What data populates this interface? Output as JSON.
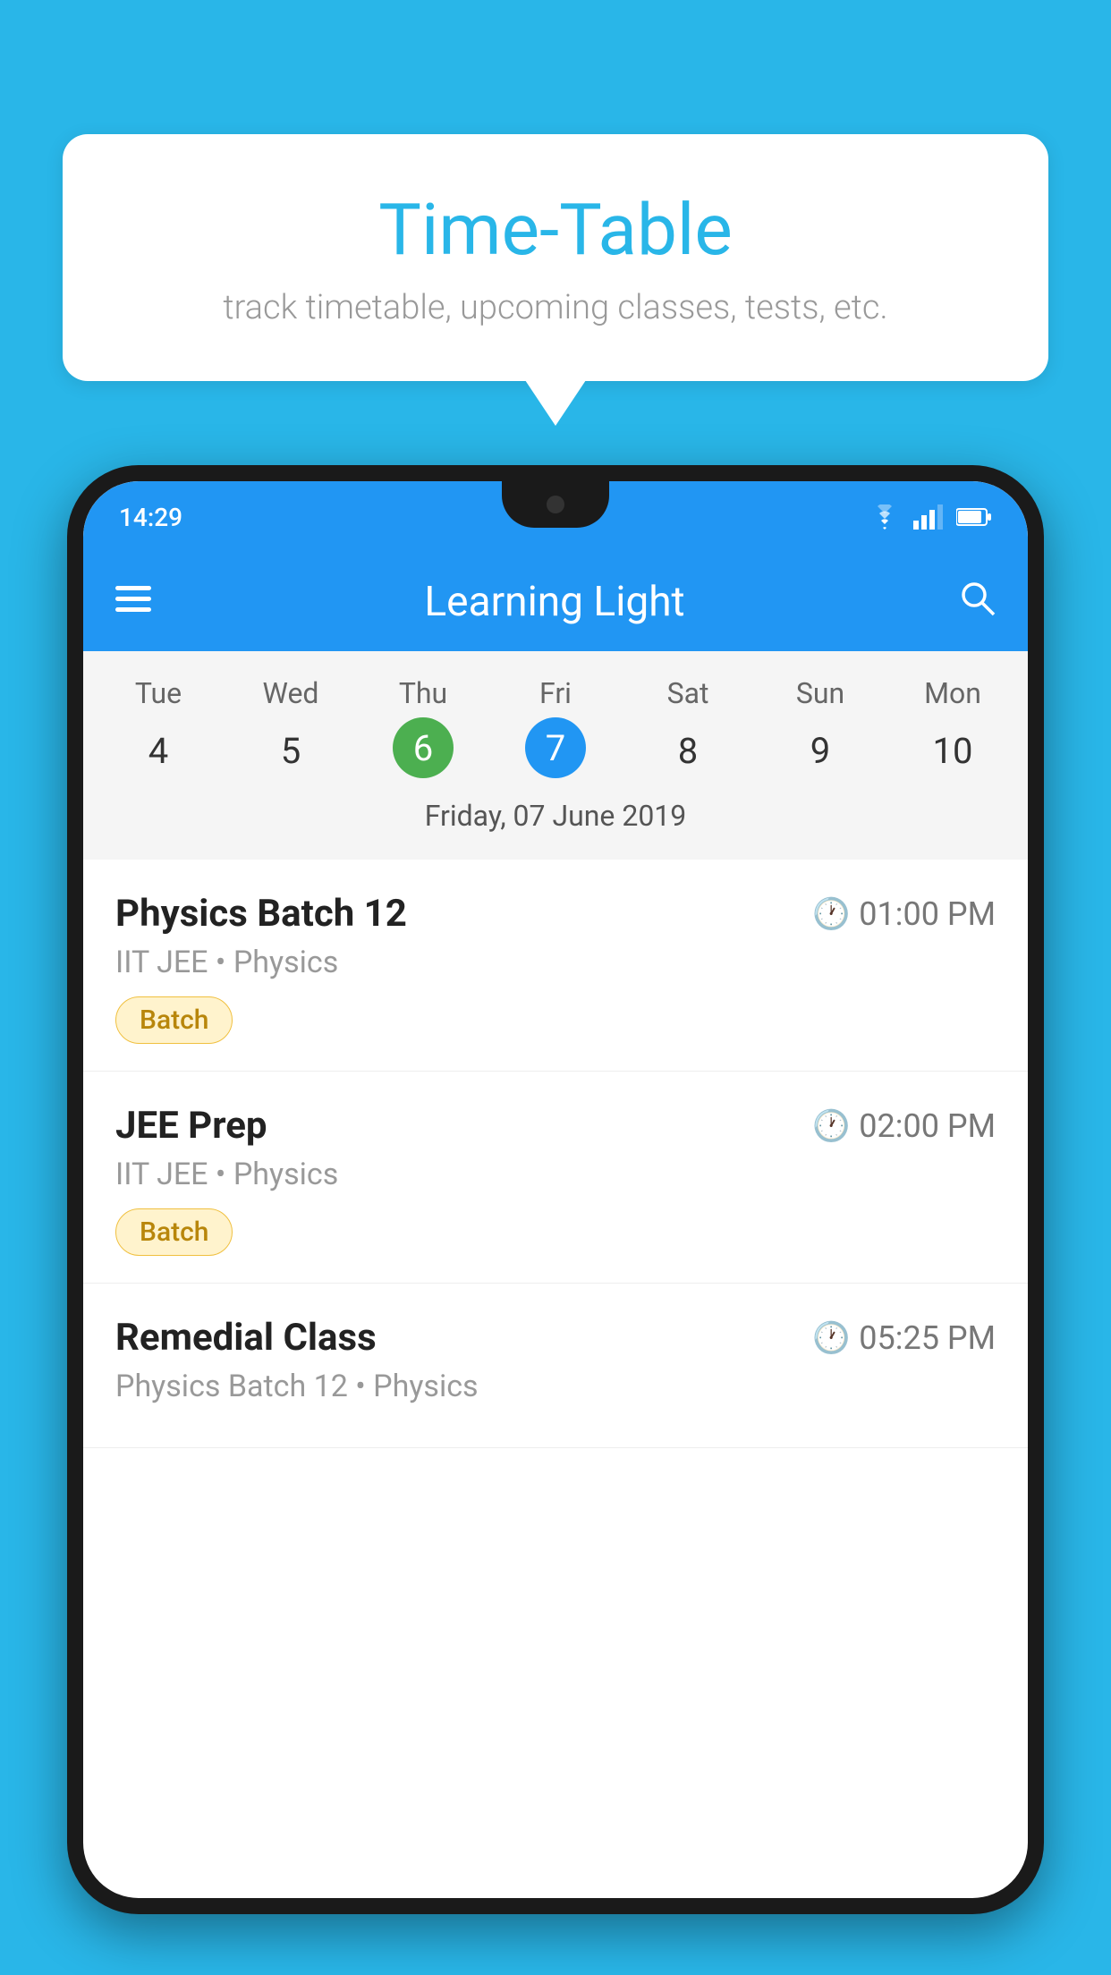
{
  "background_color": "#29B6E8",
  "bubble": {
    "title": "Time-Table",
    "subtitle": "track timetable, upcoming classes, tests, etc."
  },
  "phone": {
    "status_bar": {
      "time": "14:29",
      "icons": [
        "wifi",
        "signal",
        "battery"
      ]
    },
    "app_bar": {
      "title": "Learning Light",
      "menu_icon": "menu",
      "search_icon": "search"
    },
    "calendar": {
      "days": [
        {
          "label": "Tue",
          "number": "4"
        },
        {
          "label": "Wed",
          "number": "5"
        },
        {
          "label": "Thu",
          "number": "6",
          "state": "today"
        },
        {
          "label": "Fri",
          "number": "7",
          "state": "selected"
        },
        {
          "label": "Sat",
          "number": "8"
        },
        {
          "label": "Sun",
          "number": "9"
        },
        {
          "label": "Mon",
          "number": "10"
        }
      ],
      "selected_date_label": "Friday, 07 June 2019"
    },
    "schedule_items": [
      {
        "title": "Physics Batch 12",
        "time": "01:00 PM",
        "subtitle": "IIT JEE • Physics",
        "badge": "Batch"
      },
      {
        "title": "JEE Prep",
        "time": "02:00 PM",
        "subtitle": "IIT JEE • Physics",
        "badge": "Batch"
      },
      {
        "title": "Remedial Class",
        "time": "05:25 PM",
        "subtitle": "Physics Batch 12 • Physics",
        "badge": null
      }
    ]
  }
}
